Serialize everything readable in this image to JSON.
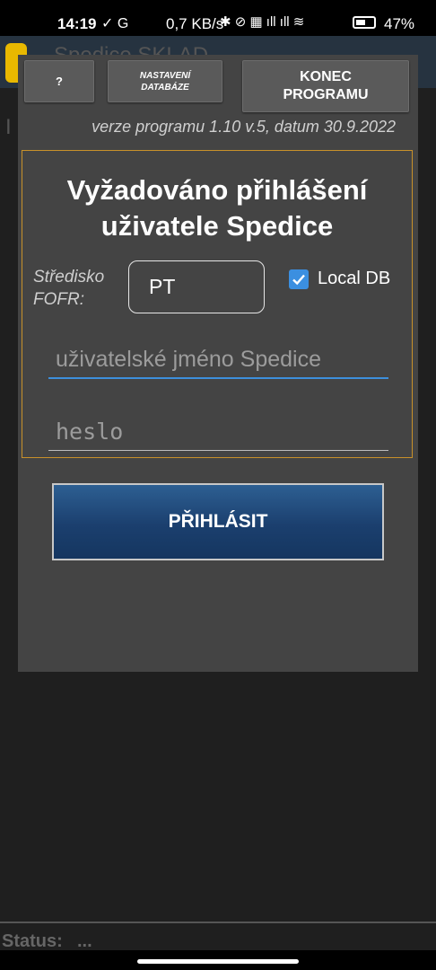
{
  "status_bar": {
    "time": "14:19",
    "left_icons": "✓ G",
    "speed": "0,7 KB/s",
    "right_icons": "✱ ⊘ ▦ ıll ıll ≋",
    "battery_pct": "47%"
  },
  "background_app": {
    "title": "Spedice SKLAD",
    "left_letter": "I",
    "status_label": "Status:",
    "status_value": "..."
  },
  "dialog": {
    "help_button": "?",
    "db_settings_button": "NASTAVENÍ\nDATABÁZE",
    "end_button": "KONEC\nPROGRAMU",
    "version": "verze programu 1.10 v.5, datum 30.9.2022",
    "login_title": "Vyžadováno přihlášení\nuživatele Spedice",
    "center_label": "Středisko\nFOFR:",
    "center_value": "PT",
    "local_db_label": "Local DB",
    "local_db_checked": true,
    "username_placeholder": "uživatelské jméno Spedice",
    "password_placeholder": "heslo",
    "login_button": "PŘIHLÁSIT"
  },
  "colors": {
    "dialog_bg": "#444444",
    "accent_blue": "#3b8fe0",
    "login_button": "#1b3f6e",
    "frame_border": "#c8912a"
  }
}
